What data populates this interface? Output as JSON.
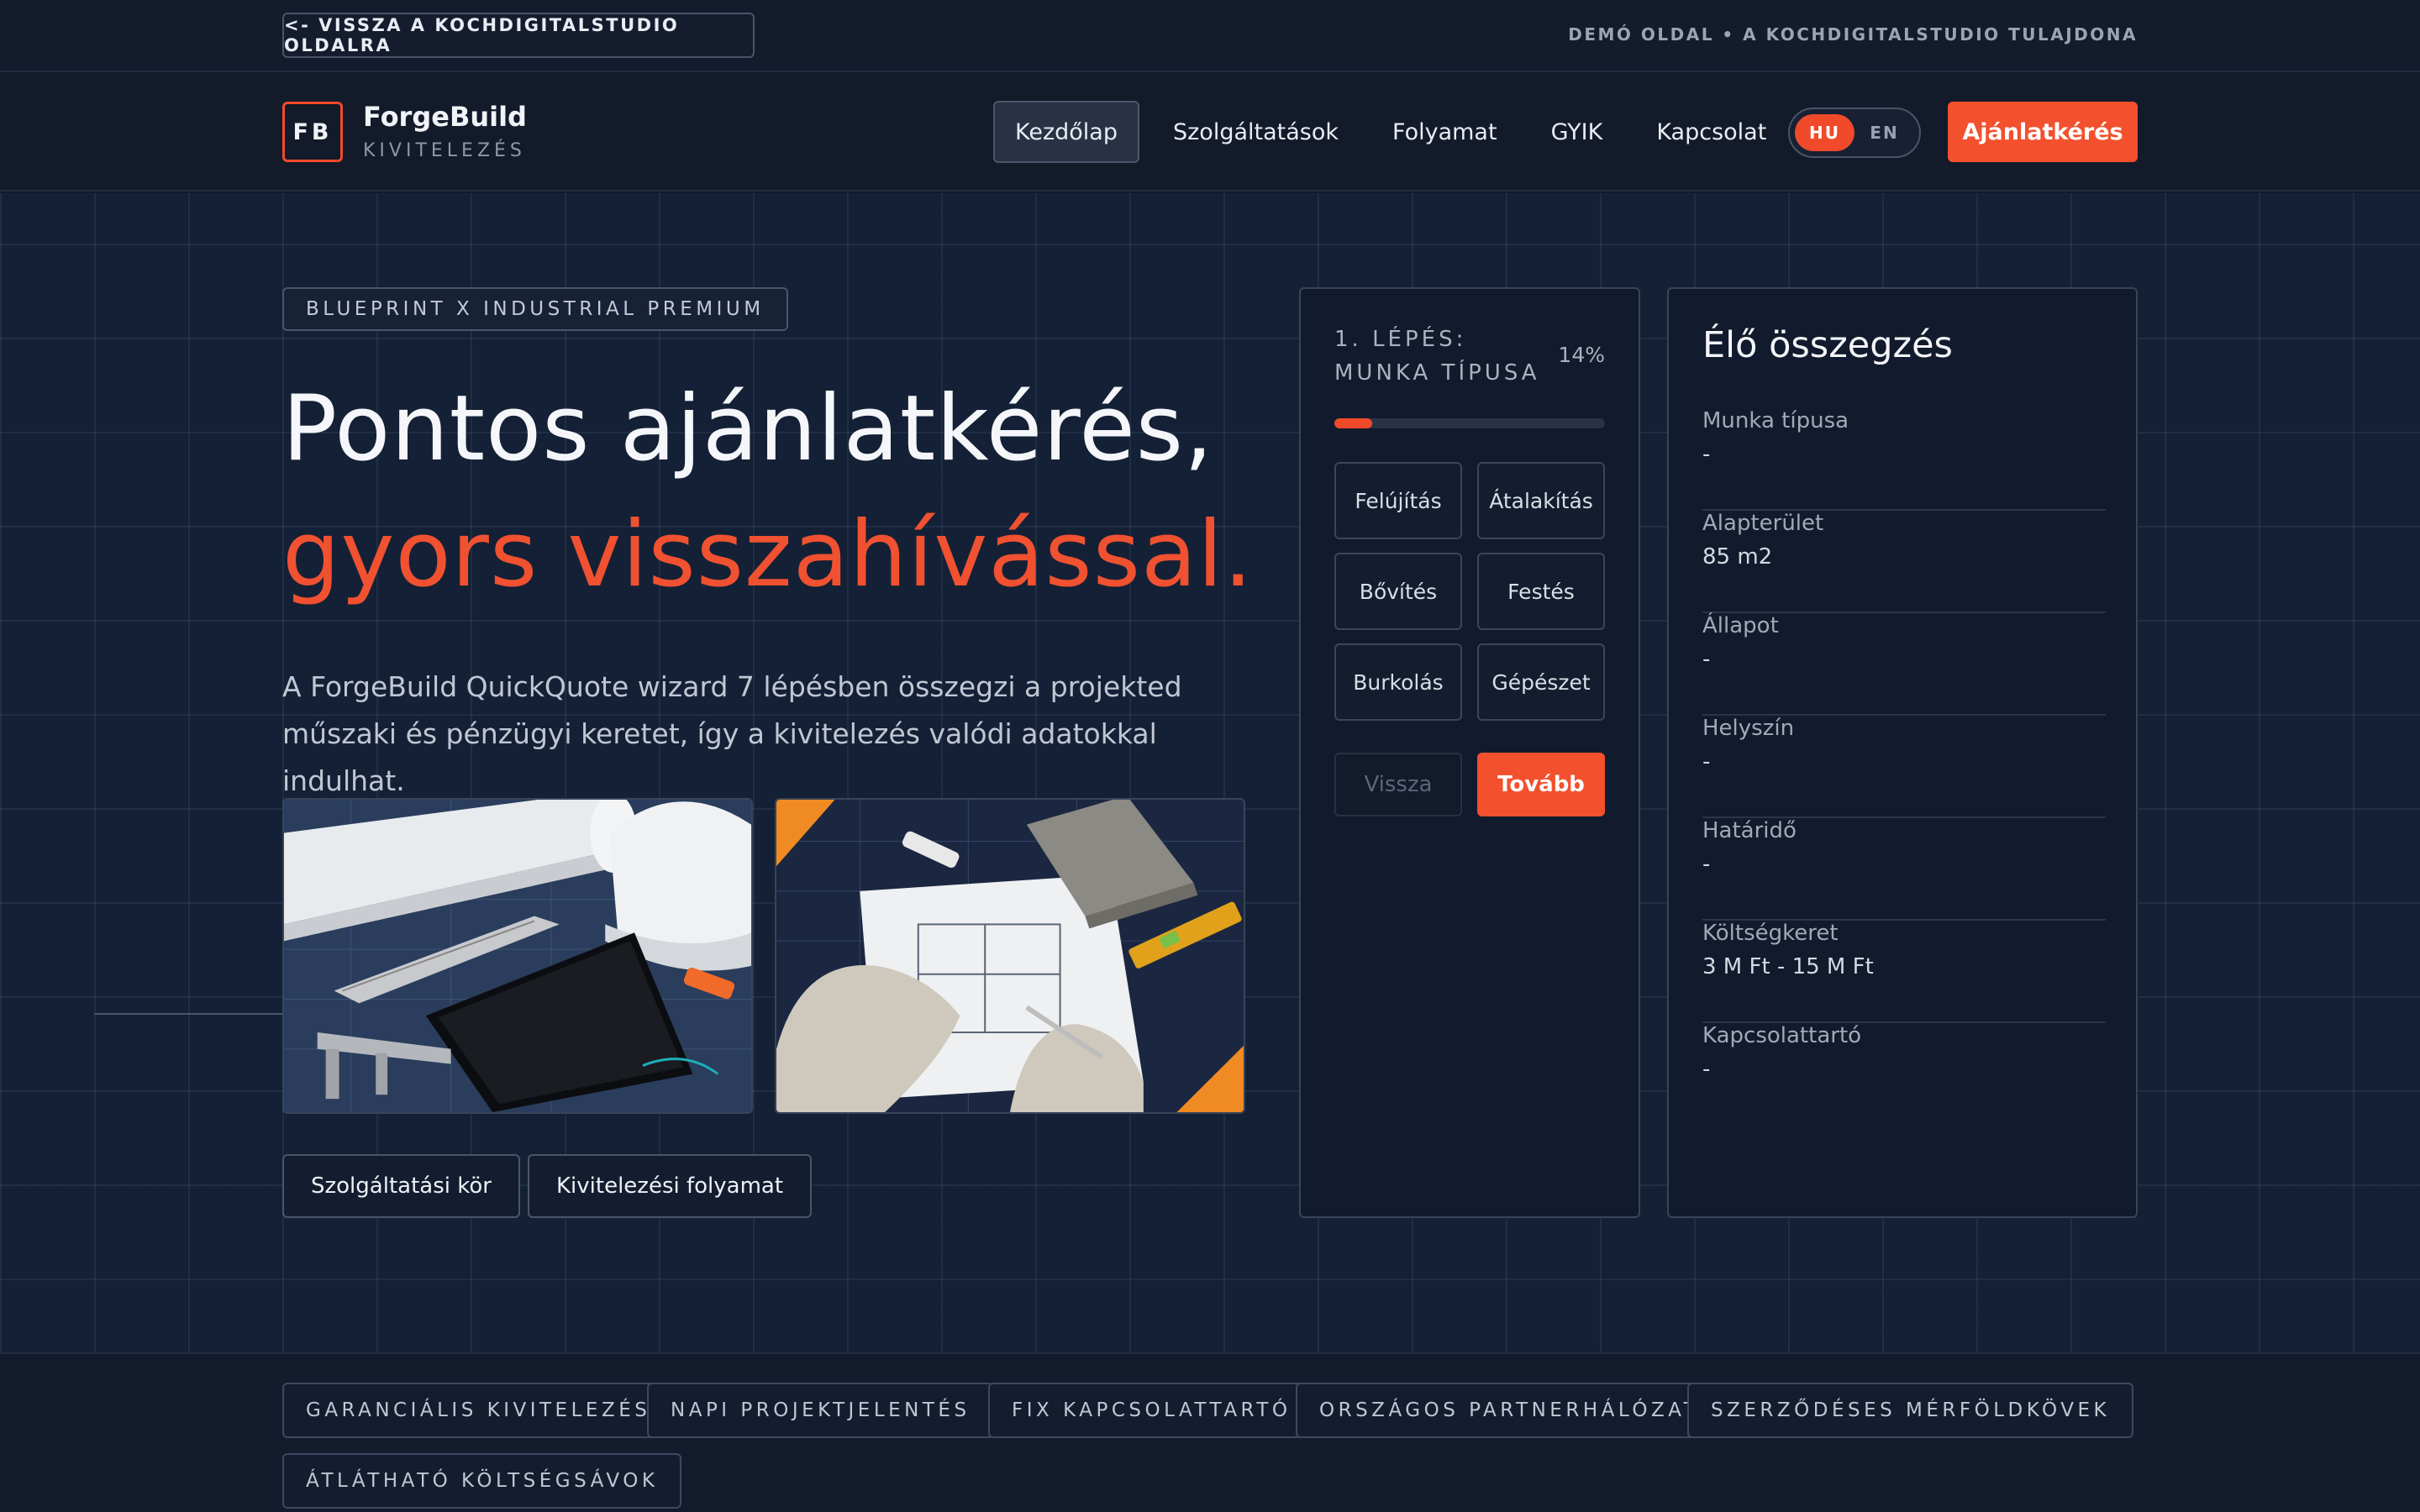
{
  "topbar": {
    "back_label": "<- VISSZA A KOCHDIGITALSTUDIO OLDALRA",
    "demo_note": "DEMÓ OLDAL • A KOCHDIGITALSTUDIO TULAJDONA"
  },
  "brand": {
    "logo": "FB",
    "name": "ForgeBuild",
    "subtitle": "KIVITELEZÉS"
  },
  "nav": {
    "items": [
      {
        "label": "Kezdőlap",
        "active": true
      },
      {
        "label": "Szolgáltatások",
        "active": false
      },
      {
        "label": "Folyamat",
        "active": false
      },
      {
        "label": "GYIK",
        "active": false
      },
      {
        "label": "Kapcsolat",
        "active": false
      }
    ],
    "lang": {
      "options": [
        "HU",
        "EN"
      ],
      "selected": "HU"
    },
    "cta": "Ajánlatkérés"
  },
  "hero": {
    "badge": "BLUEPRINT X INDUSTRIAL PREMIUM",
    "title_line1": "Pontos ajánlatkérés,",
    "title_line2": "gyors visszahívással.",
    "description": "A ForgeBuild QuickQuote wizard 7 lépésben összegzi a projekted műszaki és pénzügyi keretet, így a kivitelezés valódi adatokkal indulhat.",
    "buttons": [
      "Szolgáltatási kör",
      "Kivitelezési folyamat"
    ]
  },
  "wizard": {
    "step_title": "1. LÉPÉS: MUNKA TÍPUSA",
    "progress_label": "14%",
    "progress": 0.14,
    "options": [
      "Felújítás",
      "Átalakítás",
      "Bővítés",
      "Festés",
      "Burkolás",
      "Gépészet"
    ],
    "back_label": "Vissza",
    "next_label": "Tovább"
  },
  "summary": {
    "title": "Élő összegzés",
    "rows": [
      {
        "label": "Munka típusa",
        "value": "-"
      },
      {
        "label": "Alapterület",
        "value": "85 m2"
      },
      {
        "label": "Állapot",
        "value": "-"
      },
      {
        "label": "Helyszín",
        "value": "-"
      },
      {
        "label": "Határidő",
        "value": "-"
      },
      {
        "label": "Költségkeret",
        "value": "3 M Ft - 15 M Ft"
      },
      {
        "label": "Kapcsolattartó",
        "value": "-"
      }
    ]
  },
  "features": [
    "GARANCIÁLIS KIVITELEZÉS",
    "NAPI PROJEKTJELENTÉS",
    "FIX KAPCSOLATTARTÓ",
    "ORSZÁGOS PARTNERHÁLÓZAT",
    "SZERZŐDÉSES MÉRFÖLDKÖVEK",
    "ÁTLÁTHATÓ KÖLTSÉGSÁVOK"
  ],
  "colors": {
    "accent": "#f3502d",
    "background": "#12192a",
    "panel": "#121b2d"
  }
}
